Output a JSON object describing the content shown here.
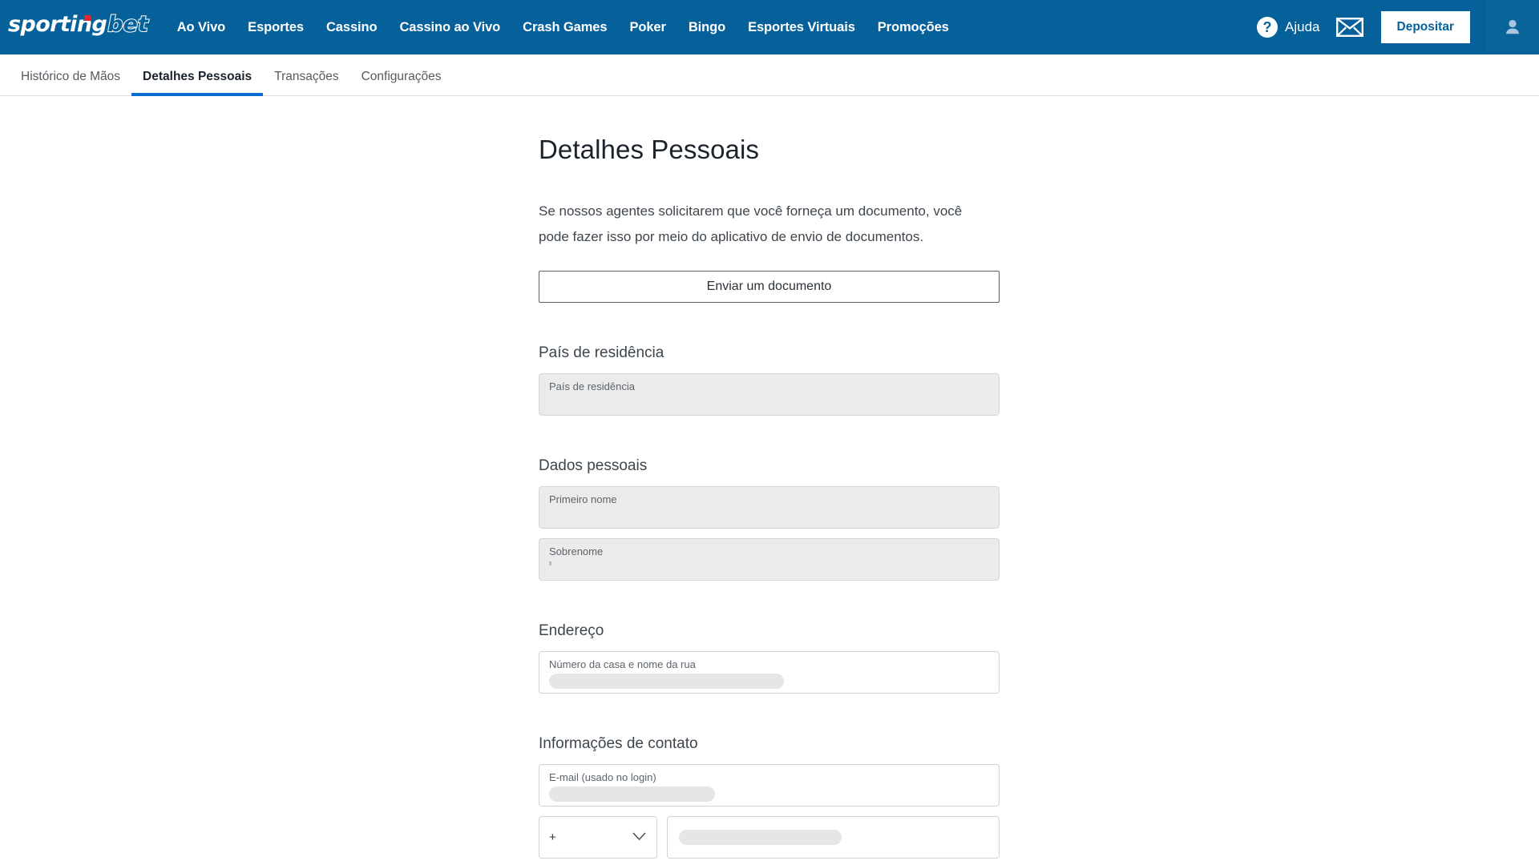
{
  "header": {
    "logo": {
      "part1": "sporting",
      "part2": "bet",
      "dot_color": "#e8262d"
    },
    "nav_items": [
      {
        "label": "Ao Vivo"
      },
      {
        "label": "Esportes"
      },
      {
        "label": "Cassino"
      },
      {
        "label": "Cassino ao Vivo"
      },
      {
        "label": "Crash Games"
      },
      {
        "label": "Poker"
      },
      {
        "label": "Bingo"
      },
      {
        "label": "Esportes Virtuais"
      },
      {
        "label": "Promoções"
      }
    ],
    "help_label": "Ajuda",
    "help_icon": "question-mark-icon",
    "messages_icon": "envelope-icon",
    "deposit_label": "Depositar",
    "account_icon": "user-avatar-icon",
    "brand_color": "#06619b",
    "accent_color": "#0b6cd4"
  },
  "subnav": {
    "tabs": [
      {
        "label": "Histórico de Mãos",
        "active": false
      },
      {
        "label": "Detalhes Pessoais",
        "active": true
      },
      {
        "label": "Transações",
        "active": false
      },
      {
        "label": "Configurações",
        "active": false
      }
    ]
  },
  "main": {
    "title": "Detalhes Pessoais",
    "intro": "Se nossos agentes solicitarem que você forneça um documento, você pode fazer isso por meio do aplicativo de envio de documentos.",
    "upload_button": "Enviar um documento",
    "sections": [
      {
        "title": "País de residência",
        "fields": [
          {
            "label": "País de residência",
            "value": "",
            "state": "disabled"
          }
        ]
      },
      {
        "title": "Dados pessoais",
        "fields": [
          {
            "label": "Primeiro nome",
            "value": "",
            "state": "disabled"
          },
          {
            "label": "Sobrenome",
            "value": "",
            "state": "disabled"
          }
        ]
      },
      {
        "title": "Endereço",
        "fields": [
          {
            "label": "Número da casa e nome da rua",
            "value": "",
            "state": "editable"
          }
        ]
      },
      {
        "title": "Informações de contato",
        "fields": [
          {
            "label": "E-mail (usado no login)",
            "value": "",
            "state": "editable"
          }
        ]
      }
    ],
    "phone": {
      "country_code_value": "+",
      "country_code_icon": "chevron-down-icon",
      "number_value": ""
    }
  }
}
